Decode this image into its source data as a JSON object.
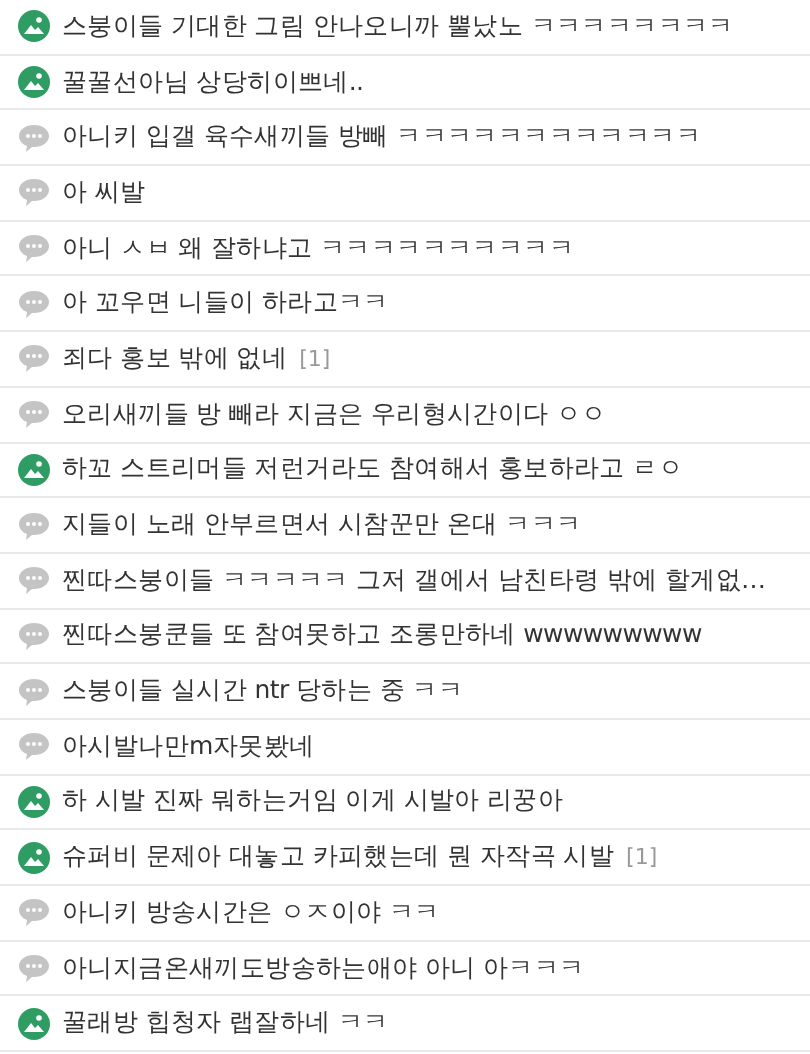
{
  "posts": [
    {
      "kind": "image",
      "title": "스붕이들 기대한 그림 안나오니까 뿔났노 ㅋㅋㅋㅋㅋㅋㅋㅋ"
    },
    {
      "kind": "image",
      "title": "꿀꿀선아님 상당히이쁘네.."
    },
    {
      "kind": "text",
      "title": "아니키 입갤 육수새끼들 방빼 ㅋㅋㅋㅋㅋㅋㅋㅋㅋㅋㅋㅋ"
    },
    {
      "kind": "text",
      "title": "아 씨발"
    },
    {
      "kind": "text",
      "title": "아니 ㅅㅂ 왜 잘하냐고 ㅋㅋㅋㅋㅋㅋㅋㅋㅋㅋ"
    },
    {
      "kind": "text",
      "title": "아 꼬우면 니들이 하라고ㅋㅋ"
    },
    {
      "kind": "text",
      "title": "죄다 홍보 밖에 없네",
      "comments": "[1]"
    },
    {
      "kind": "text",
      "title": "오리새끼들 방 빼라 지금은 우리형시간이다 ㅇㅇ"
    },
    {
      "kind": "image",
      "title": "하꼬 스트리머들 저런거라도 참여해서 홍보하라고 ㄹㅇ"
    },
    {
      "kind": "text",
      "title": "지들이 노래 안부르면서 시참꾼만 온대 ㅋㅋㅋ"
    },
    {
      "kind": "text",
      "title": "찐따스붕이들 ㅋㅋㅋㅋㅋ 그저 갤에서 남친타령 밖에 할게없…"
    },
    {
      "kind": "text",
      "title": "찐따스붕쿤들 또 참여못하고 조롱만하네 wwwwwwwww"
    },
    {
      "kind": "text",
      "title": "스붕이들 실시간 ntr 당하는 중 ㅋㅋ"
    },
    {
      "kind": "text",
      "title": "아시발나만m자못봤네"
    },
    {
      "kind": "image",
      "title": "하 시발 진짜 뭐하는거임 이게 시발아 리꿍아"
    },
    {
      "kind": "image",
      "title": "슈퍼비 문제아 대놓고 카피했는데 뭔 자작곡 시발",
      "comments": "[1]"
    },
    {
      "kind": "text",
      "title": "아니키 방송시간은 ㅇㅈ이야 ㅋㅋ"
    },
    {
      "kind": "text",
      "title": "아니지금온새끼도방송하는애야 아니 아ㅋㅋㅋ"
    },
    {
      "kind": "image",
      "title": "꿀래방 힙청자 랩잘하네 ㅋㅋ"
    }
  ]
}
